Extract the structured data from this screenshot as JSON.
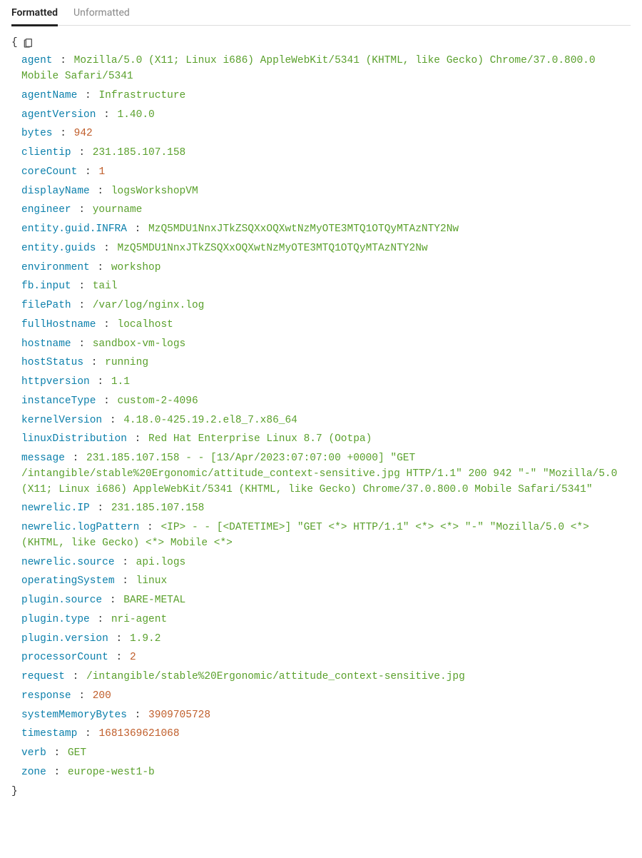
{
  "tabs": {
    "formatted": "Formatted",
    "unformatted": "Unformatted"
  },
  "braces": {
    "open": "{",
    "close": "}"
  },
  "fields": [
    {
      "key": "agent",
      "value": "Mozilla/5.0 (X11; Linux i686) AppleWebKit/5341 (KHTML, like Gecko) Chrome/37.0.800.0 Mobile Safari/5341",
      "type": "str"
    },
    {
      "key": "agentName",
      "value": "Infrastructure",
      "type": "str"
    },
    {
      "key": "agentVersion",
      "value": "1.40.0",
      "type": "str"
    },
    {
      "key": "bytes",
      "value": "942",
      "type": "num"
    },
    {
      "key": "clientip",
      "value": "231.185.107.158",
      "type": "str"
    },
    {
      "key": "coreCount",
      "value": "1",
      "type": "num"
    },
    {
      "key": "displayName",
      "value": "logsWorkshopVM",
      "type": "str"
    },
    {
      "key": "engineer",
      "value": "yourname",
      "type": "str"
    },
    {
      "key": "entity.guid.INFRA",
      "value": "MzQ5MDU1NnxJTkZSQXxOQXwtNzMyOTE3MTQ1OTQyMTAzNTY2Nw",
      "type": "str"
    },
    {
      "key": "entity.guids",
      "value": "MzQ5MDU1NnxJTkZSQXxOQXwtNzMyOTE3MTQ1OTQyMTAzNTY2Nw",
      "type": "str"
    },
    {
      "key": "environment",
      "value": "workshop",
      "type": "str"
    },
    {
      "key": "fb.input",
      "value": "tail",
      "type": "str"
    },
    {
      "key": "filePath",
      "value": "/var/log/nginx.log",
      "type": "str"
    },
    {
      "key": "fullHostname",
      "value": "localhost",
      "type": "str"
    },
    {
      "key": "hostname",
      "value": "sandbox-vm-logs",
      "type": "str"
    },
    {
      "key": "hostStatus",
      "value": "running",
      "type": "str"
    },
    {
      "key": "httpversion",
      "value": "1.1",
      "type": "str"
    },
    {
      "key": "instanceType",
      "value": "custom-2-4096",
      "type": "str"
    },
    {
      "key": "kernelVersion",
      "value": "4.18.0-425.19.2.el8_7.x86_64",
      "type": "str"
    },
    {
      "key": "linuxDistribution",
      "value": "Red Hat Enterprise Linux 8.7 (Ootpa)",
      "type": "str"
    },
    {
      "key": "message",
      "value": "231.185.107.158 - - [13/Apr/2023:07:07:00 +0000] \"GET /intangible/stable%20Ergonomic/attitude_context-sensitive.jpg HTTP/1.1\" 200 942 \"-\" \"Mozilla/5.0 (X11; Linux i686) AppleWebKit/5341 (KHTML, like Gecko) Chrome/37.0.800.0 Mobile Safari/5341\"",
      "type": "str"
    },
    {
      "key": "newrelic.IP",
      "value": "231.185.107.158",
      "type": "str"
    },
    {
      "key": "newrelic.logPattern",
      "value": "<IP> - - [<DATETIME>] \"GET <*> HTTP/1.1\" <*> <*> \"-\" \"Mozilla/5.0 <*> (KHTML, like Gecko) <*> Mobile <*>",
      "type": "str"
    },
    {
      "key": "newrelic.source",
      "value": "api.logs",
      "type": "str"
    },
    {
      "key": "operatingSystem",
      "value": "linux",
      "type": "str"
    },
    {
      "key": "plugin.source",
      "value": "BARE-METAL",
      "type": "str"
    },
    {
      "key": "plugin.type",
      "value": "nri-agent",
      "type": "str"
    },
    {
      "key": "plugin.version",
      "value": "1.9.2",
      "type": "str"
    },
    {
      "key": "processorCount",
      "value": "2",
      "type": "num"
    },
    {
      "key": "request",
      "value": "/intangible/stable%20Ergonomic/attitude_context-sensitive.jpg",
      "type": "str"
    },
    {
      "key": "response",
      "value": "200",
      "type": "num"
    },
    {
      "key": "systemMemoryBytes",
      "value": "3909705728",
      "type": "num"
    },
    {
      "key": "timestamp",
      "value": "1681369621068",
      "type": "num"
    },
    {
      "key": "verb",
      "value": "GET",
      "type": "str"
    },
    {
      "key": "zone",
      "value": "europe-west1-b",
      "type": "str"
    }
  ]
}
